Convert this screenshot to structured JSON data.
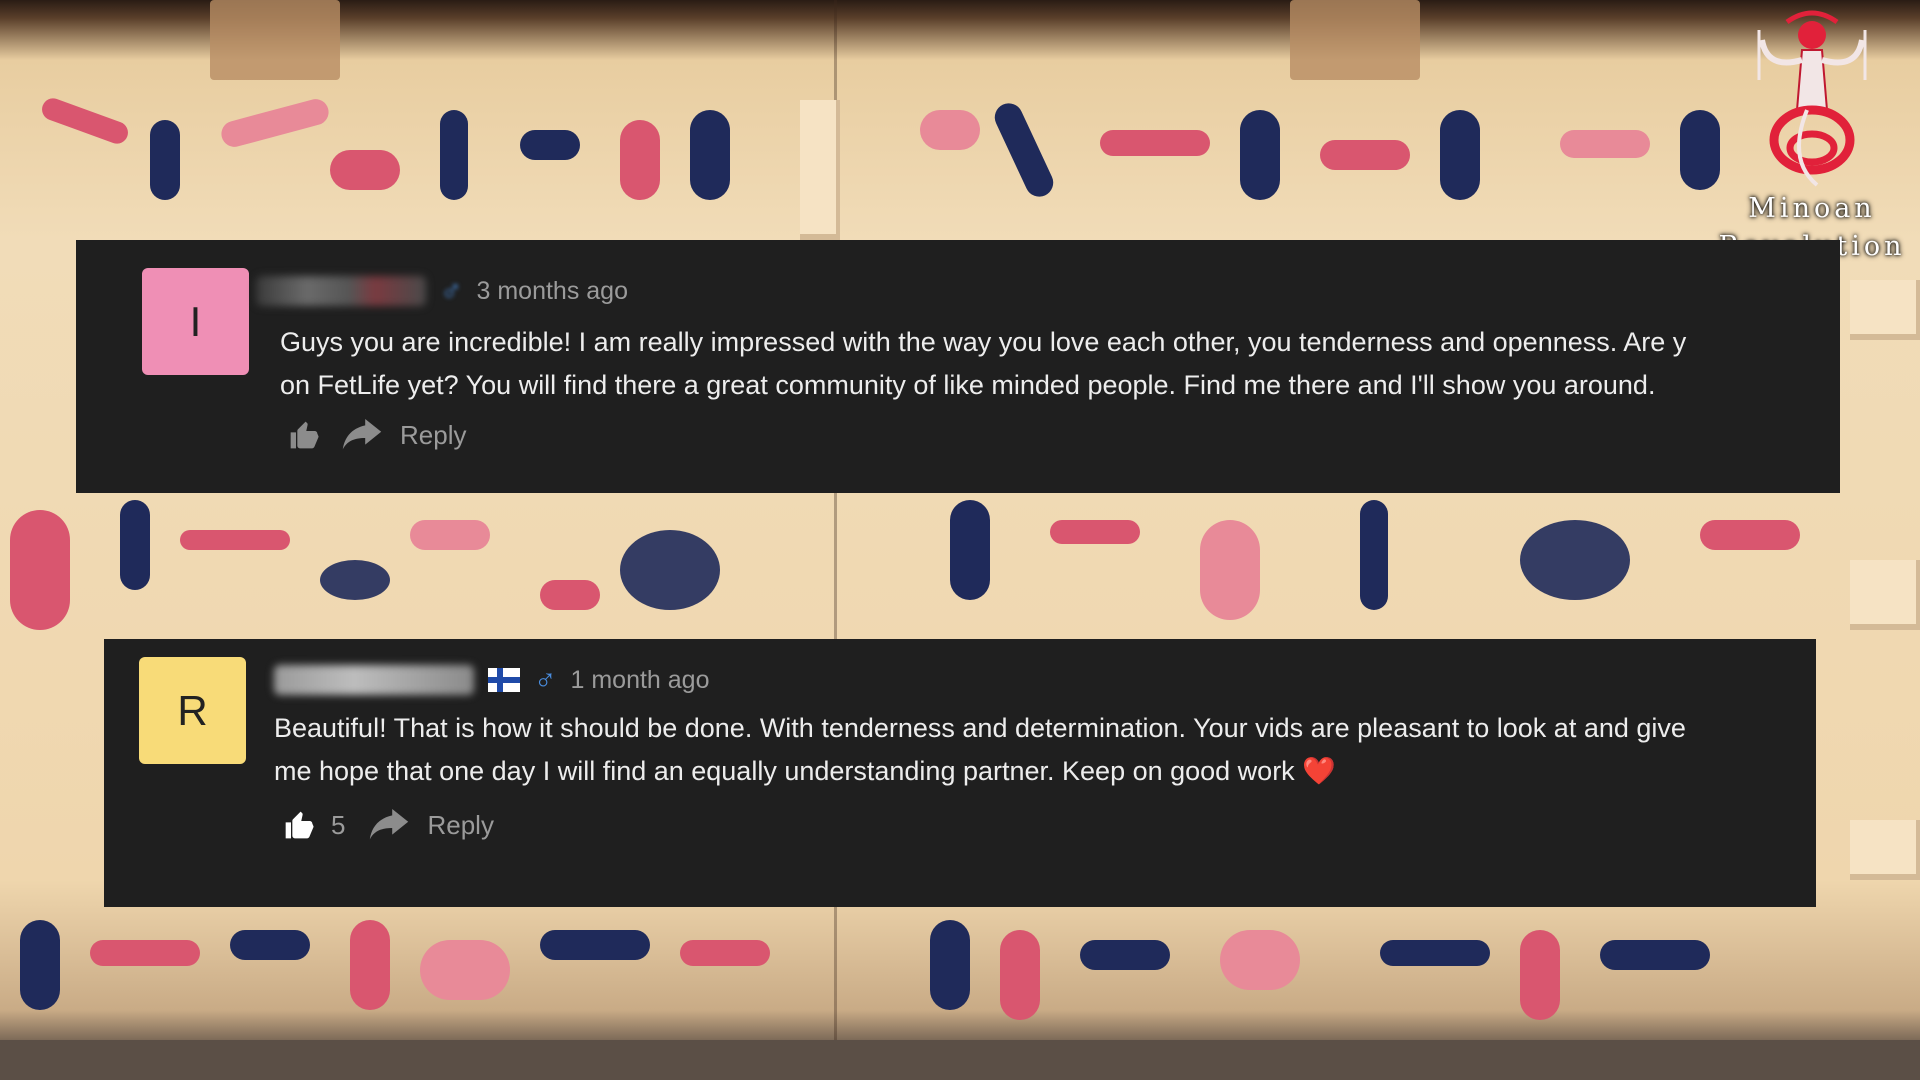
{
  "logo": {
    "line1": "Minoan",
    "line2": "Revolution"
  },
  "comments": [
    {
      "avatar_letter": "I",
      "avatar_color": "#ef8fb5",
      "timestamp": "3 months ago",
      "text": "Guys you are incredible! I am really impressed with the way you love each other, you tenderness and openness. Are y\non FetLife yet? You will find there a great community of like minded people. Find me there and I'll show you around.",
      "reply_label": "Reply",
      "like_icon": "thumbs-up-icon",
      "reply_icon": "reply-arrow-icon"
    },
    {
      "avatar_letter": "R",
      "avatar_color": "#f8db78",
      "timestamp": "1 month ago",
      "text": "Beautiful! That is how it should be done. With tenderness and determination. Your vids are pleasant to look at and give\nme hope that one day I will find an equally understanding partner. Keep on good work",
      "like_count": "5",
      "reply_label": "Reply",
      "emoji": "❤️"
    }
  ]
}
